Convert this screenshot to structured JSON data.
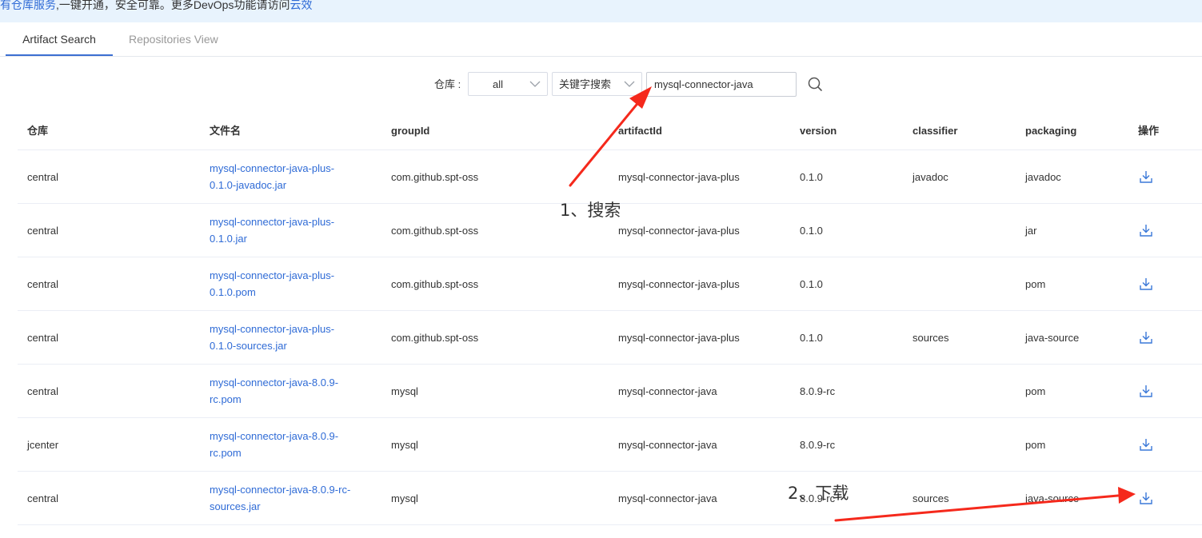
{
  "banner": {
    "link1": "有仓库服务",
    "text": ",一键开通，安全可靠。更多DevOps功能请访问",
    "link2": "云效"
  },
  "tabs": [
    {
      "label": "Artifact Search",
      "active": true
    },
    {
      "label": "Repositories View",
      "active": false
    }
  ],
  "filters": {
    "repo_label": "仓库 :",
    "repo_value": "all",
    "mode_value": "关键字搜索",
    "search_value": "mysql-connector-java"
  },
  "table": {
    "headers": [
      "仓库",
      "文件名",
      "groupId",
      "artifactId",
      "version",
      "classifier",
      "packaging",
      "操作"
    ],
    "rows": [
      {
        "repo": "central",
        "file_line1": "mysql-connector-java-plus-",
        "file_line2": "0.1.0-javadoc.jar",
        "groupId": "com.github.spt-oss",
        "artifactId": "mysql-connector-java-plus",
        "version": "0.1.0",
        "classifier": "javadoc",
        "packaging": "javadoc"
      },
      {
        "repo": "central",
        "file_line1": "mysql-connector-java-plus-",
        "file_line2": "0.1.0.jar",
        "groupId": "com.github.spt-oss",
        "artifactId": "mysql-connector-java-plus",
        "version": "0.1.0",
        "classifier": "",
        "packaging": "jar"
      },
      {
        "repo": "central",
        "file_line1": "mysql-connector-java-plus-",
        "file_line2": "0.1.0.pom",
        "groupId": "com.github.spt-oss",
        "artifactId": "mysql-connector-java-plus",
        "version": "0.1.0",
        "classifier": "",
        "packaging": "pom"
      },
      {
        "repo": "central",
        "file_line1": "mysql-connector-java-plus-",
        "file_line2": "0.1.0-sources.jar",
        "groupId": "com.github.spt-oss",
        "artifactId": "mysql-connector-java-plus",
        "version": "0.1.0",
        "classifier": "sources",
        "packaging": "java-source"
      },
      {
        "repo": "central",
        "file_line1": "mysql-connector-java-8.0.9-",
        "file_line2": "rc.pom",
        "groupId": "mysql",
        "artifactId": "mysql-connector-java",
        "version": "8.0.9-rc",
        "classifier": "",
        "packaging": "pom"
      },
      {
        "repo": "jcenter",
        "file_line1": "mysql-connector-java-8.0.9-",
        "file_line2": "rc.pom",
        "groupId": "mysql",
        "artifactId": "mysql-connector-java",
        "version": "8.0.9-rc",
        "classifier": "",
        "packaging": "pom"
      },
      {
        "repo": "central",
        "file_line1": "mysql-connector-java-8.0.9-rc-",
        "file_line2": "sources.jar",
        "groupId": "mysql",
        "artifactId": "mysql-connector-java",
        "version": "8.0.9-rc",
        "classifier": "sources",
        "packaging": "java-source"
      }
    ]
  },
  "annotations": {
    "step1": "1、搜索",
    "step2": "2、下载"
  },
  "colors": {
    "link": "#2f6bd6",
    "active_tab_underline": "#3c6fd1",
    "banner_bg": "#e8f3fd",
    "annotation_arrow": "#f5291c"
  },
  "icons": {
    "search": "search-icon",
    "download": "download-icon",
    "dropdown": "chevron-down-icon"
  }
}
